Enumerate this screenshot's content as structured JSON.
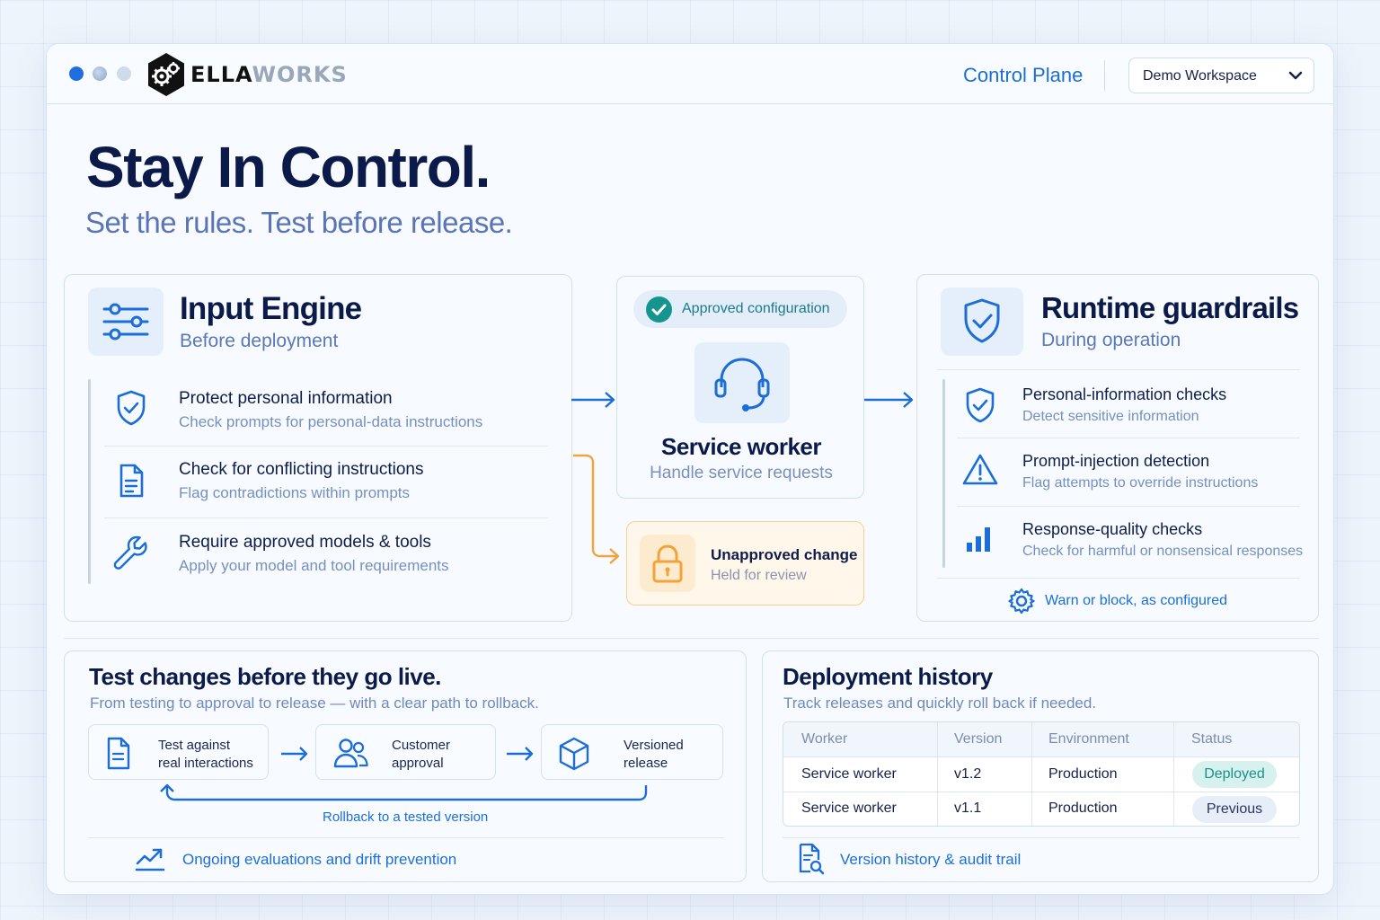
{
  "app": {
    "logo_text_a": "ELLA",
    "logo_text_b": "WORKS",
    "nav_title": "Control Plane",
    "workspace": "Demo Workspace"
  },
  "hero": {
    "title": "Stay In Control.",
    "subtitle": "Set the rules. Test before release."
  },
  "input_engine": {
    "title": "Input Engine",
    "subtitle": "Before deployment",
    "items": [
      {
        "title": "Protect personal information",
        "desc": "Check prompts for personal-data instructions",
        "icon": "shield-check-icon"
      },
      {
        "title": "Check for conflicting instructions",
        "desc": "Flag contradictions within prompts",
        "icon": "document-icon"
      },
      {
        "title": "Require approved models & tools",
        "desc": "Apply your model and tool requirements",
        "icon": "wrench-icon"
      }
    ]
  },
  "service_worker": {
    "badge": "Approved configuration",
    "title": "Service worker",
    "subtitle": "Handle service requests"
  },
  "unapproved": {
    "title": "Unapproved change",
    "subtitle": "Held for review"
  },
  "runtime": {
    "title": "Runtime guardrails",
    "subtitle": "During operation",
    "items": [
      {
        "title": "Personal-information checks",
        "desc": "Detect sensitive information",
        "icon": "shield-check-icon"
      },
      {
        "title": "Prompt-injection detection",
        "desc": "Flag attempts to override instructions",
        "icon": "warning-icon"
      },
      {
        "title": "Response-quality checks",
        "desc": "Check for harmful or nonsensical responses",
        "icon": "bar-chart-icon"
      }
    ],
    "footer": "Warn or block, as configured"
  },
  "testing": {
    "title": "Test changes before they go live.",
    "subtitle": "From testing to approval to release — with a clear path to rollback.",
    "steps": [
      {
        "line1": "Test against",
        "line2": "real interactions"
      },
      {
        "line1": "Customer",
        "line2": "approval"
      },
      {
        "line1": "Versioned",
        "line2": "release"
      }
    ],
    "rollback": "Rollback to a tested version",
    "footer": "Ongoing evaluations and drift prevention"
  },
  "history": {
    "title": "Deployment history",
    "subtitle": "Track releases and quickly roll back if needed.",
    "columns": [
      "Worker",
      "Version",
      "Environment",
      "Status"
    ],
    "rows": [
      {
        "worker": "Service worker",
        "version": "v1.2",
        "environment": "Production",
        "status": "Deployed"
      },
      {
        "worker": "Service worker",
        "version": "v1.1",
        "environment": "Production",
        "status": "Previous"
      }
    ],
    "footer": "Version history & audit trail"
  },
  "colors": {
    "accent": "#1c6ed6",
    "navy": "#0c1a4a",
    "warning": "#f2a33a",
    "success": "#14958e"
  }
}
